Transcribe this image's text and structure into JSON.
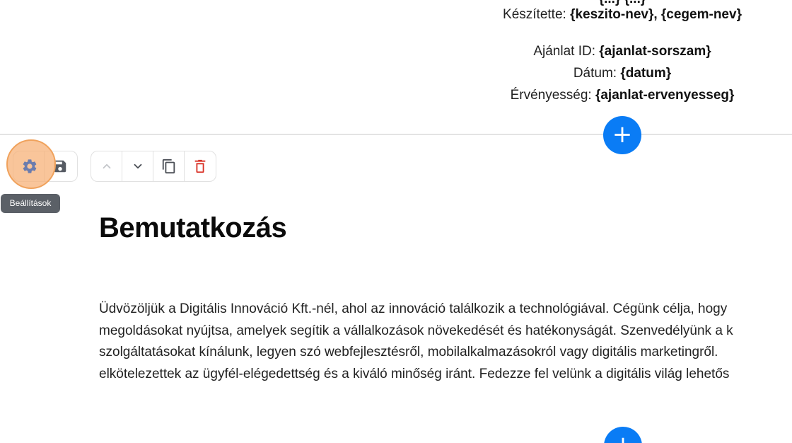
{
  "header_meta": {
    "top_partial_text": "{...} {...}",
    "made_by_label": "Készítette: ",
    "made_by_value": "{keszito-nev}, {cegem-nev}",
    "offer_id_label": "Ajánlat ID: ",
    "offer_id_value": "{ajanlat-sorszam}",
    "date_label": "Dátum: ",
    "date_value": "{datum}",
    "validity_label": "Érvényesség: ",
    "validity_value": "{ajanlat-ervenyesseg}"
  },
  "add_button": {
    "label": "+"
  },
  "toolbar": {
    "settings_tooltip": "Beállítások",
    "icons": [
      "gear-icon",
      "save-icon",
      "chevron-up-icon",
      "chevron-down-icon",
      "copy-icon",
      "trash-icon"
    ]
  },
  "section": {
    "title": "Bemutatkozás",
    "paragraph_lines": [
      "Üdvözöljük a Digitális Innováció Kft.-nél, ahol az innováció találkozik a technológiával. Cégünk célja, hogy",
      "megoldásokat nyújtsa, amelyek segítik a vállalkozások növekedését és hatékonyságát. Szenvedélyünk a k",
      "szolgáltatásokat kínálunk, legyen szó webfejlesztésről, mobilalkalmazásokról vagy digitális marketingről.",
      "elkötelezettek az ügyfél-elégedettség és a kiváló minőség iránt. Fedezze fel velünk a digitális világ lehetős"
    ]
  },
  "colors": {
    "accent_blue": "#0a7cf5",
    "delete_red": "#d93025",
    "highlight_orange": "#f0a25c",
    "tooltip_bg": "#5b6067"
  }
}
